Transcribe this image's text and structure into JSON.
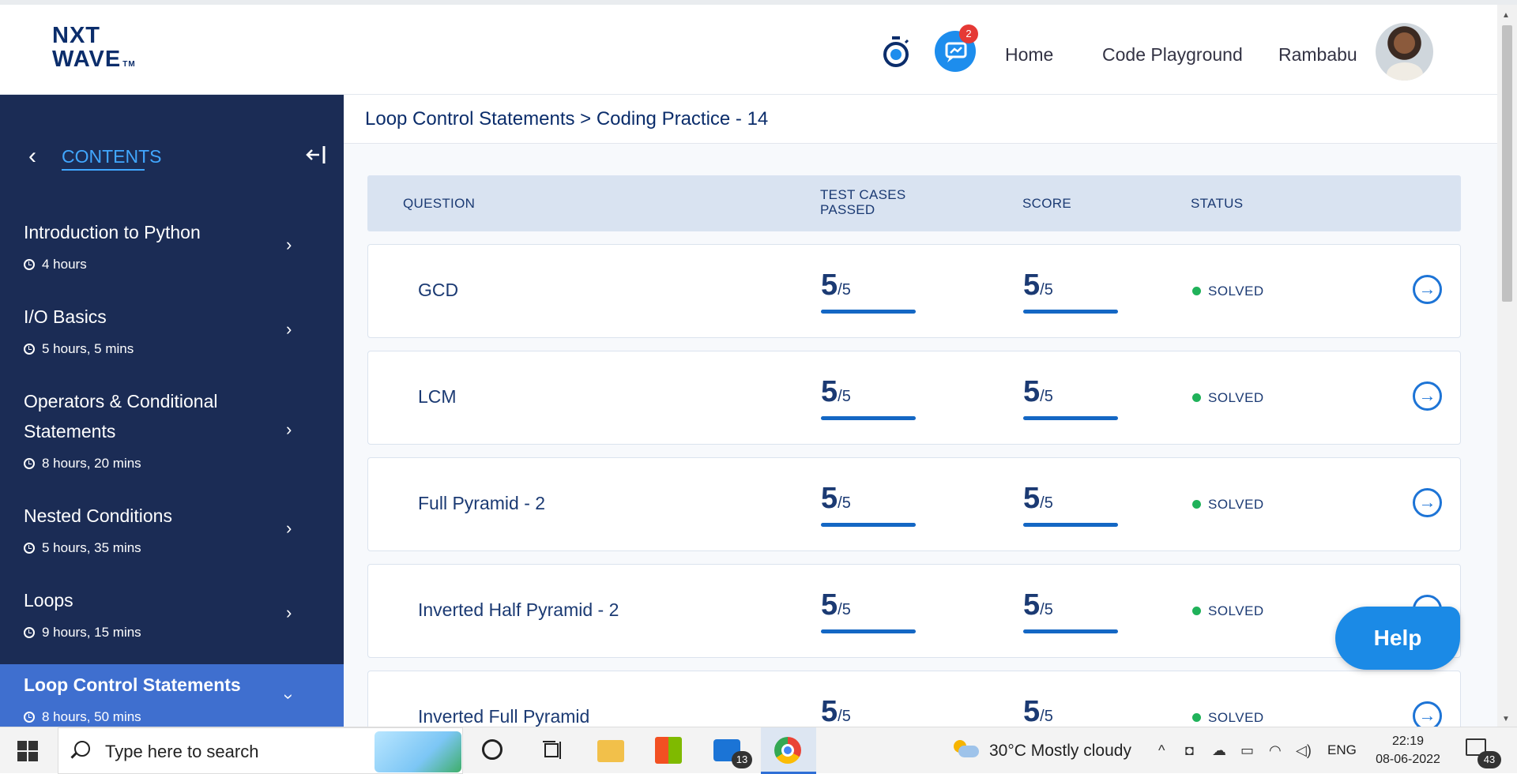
{
  "header": {
    "logo_line1": "NXT",
    "logo_line2": "WAVE",
    "logo_tm": "TM",
    "chat_badge": "2",
    "nav": [
      {
        "label": "Home"
      },
      {
        "label": "Code Playground"
      }
    ],
    "user_name": "Rambabu"
  },
  "sidebar": {
    "contents_label": "CONTENTS",
    "modules": [
      {
        "title": "Introduction to Python",
        "duration": "4 hours"
      },
      {
        "title": "I/O Basics",
        "duration": "5 hours, 5 mins"
      },
      {
        "title_line1": "Operators & Conditional",
        "title_line2": "Statements",
        "duration": "8 hours, 20 mins"
      },
      {
        "title": "Nested Conditions",
        "duration": "5 hours, 35 mins"
      },
      {
        "title": "Loops",
        "duration": "9 hours, 15 mins"
      },
      {
        "title": "Loop Control Statements",
        "duration": "8 hours, 50 mins",
        "active": true
      }
    ]
  },
  "breadcrumb": "Loop Control Statements > Coding Practice - 14",
  "table": {
    "headers": {
      "question": "QUESTION",
      "test_cases_line1": "TEST CASES",
      "test_cases_line2": "PASSED",
      "score": "SCORE",
      "status": "STATUS"
    },
    "rows": [
      {
        "question": "GCD",
        "tc_passed": "5",
        "tc_total": "/5",
        "score": "5",
        "score_total": "/5",
        "status": "SOLVED",
        "progress": 1.0
      },
      {
        "question": "LCM",
        "tc_passed": "5",
        "tc_total": "/5",
        "score": "5",
        "score_total": "/5",
        "status": "SOLVED",
        "progress": 1.0
      },
      {
        "question": "Full Pyramid - 2",
        "tc_passed": "5",
        "tc_total": "/5",
        "score": "5",
        "score_total": "/5",
        "status": "SOLVED",
        "progress": 1.0
      },
      {
        "question": "Inverted Half Pyramid - 2",
        "tc_passed": "5",
        "tc_total": "/5",
        "score": "5",
        "score_total": "/5",
        "status": "SOLVED",
        "progress": 1.0
      },
      {
        "question": "Inverted Full Pyramid",
        "tc_passed": "5",
        "tc_total": "/5",
        "score": "5",
        "score_total": "/5",
        "status": "SOLVED",
        "progress": 1.0
      }
    ]
  },
  "help_label": "Help",
  "taskbar": {
    "search_placeholder": "Type here to search",
    "mail_badge": "13",
    "weather": "30°C  Mostly cloudy",
    "language": "ENG",
    "time": "22:19",
    "date": "08-06-2022",
    "notification_badge": "43"
  },
  "colors": {
    "sidebar_bg": "#1b2c55",
    "active_module": "#3f6fcf",
    "accent": "#1b8ae6",
    "solved": "#20b25a",
    "brand": "#0b2d6b"
  }
}
